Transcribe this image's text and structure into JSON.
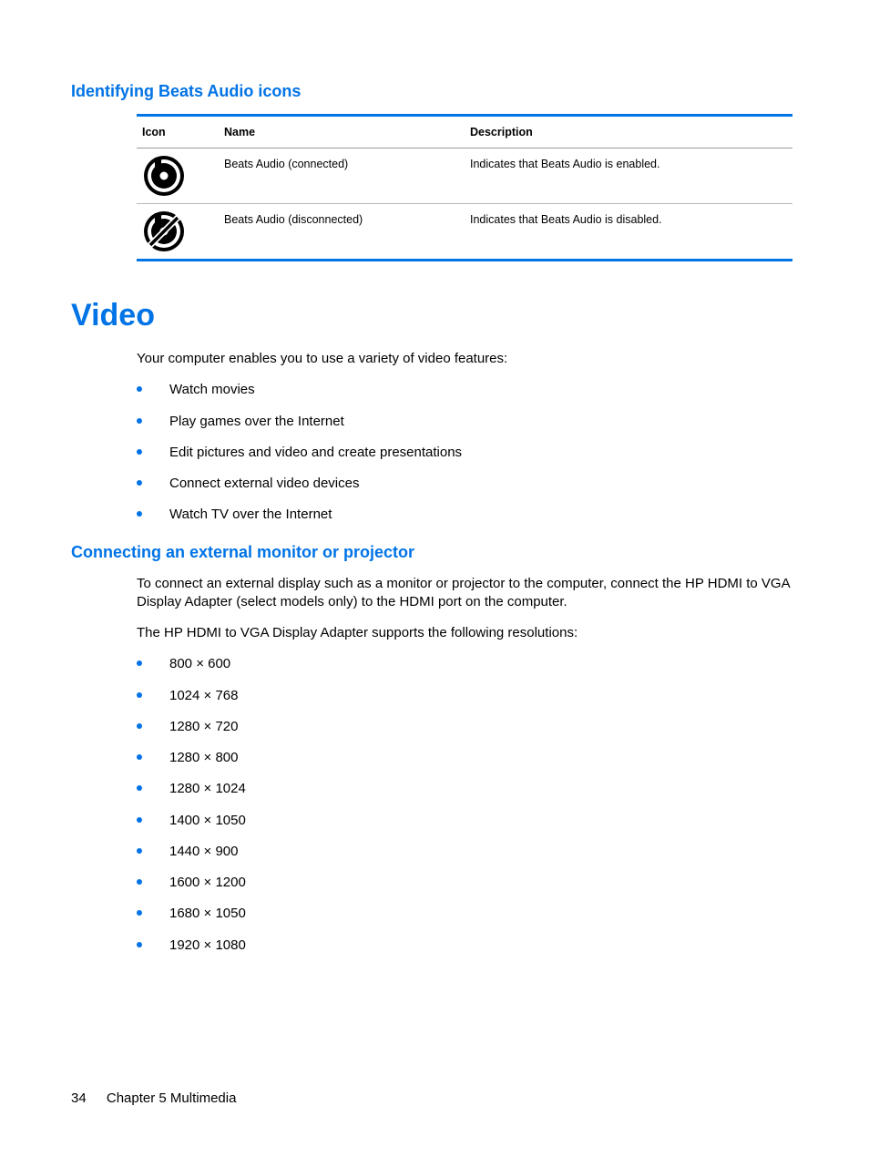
{
  "section1": {
    "heading": "Identifying Beats Audio icons",
    "table": {
      "headers": {
        "icon": "Icon",
        "name": "Name",
        "description": "Description"
      },
      "rows": [
        {
          "name": "Beats Audio (connected)",
          "description": "Indicates that Beats Audio is enabled."
        },
        {
          "name": "Beats Audio (disconnected)",
          "description": "Indicates that Beats Audio is disabled."
        }
      ]
    }
  },
  "section2": {
    "heading": "Video",
    "intro": "Your computer enables you to use a variety of video features:",
    "features": [
      "Watch movies",
      "Play games over the Internet",
      "Edit pictures and video and create presentations",
      "Connect external video devices",
      "Watch TV over the Internet"
    ]
  },
  "section3": {
    "heading": "Connecting an external monitor or projector",
    "para1": "To connect an external display such as a monitor or projector to the computer, connect the HP HDMI to VGA Display Adapter (select models only) to the HDMI port on the computer.",
    "para2": "The HP HDMI to VGA Display Adapter supports the following resolutions:",
    "resolutions": [
      "800 × 600",
      "1024 × 768",
      "1280 × 720",
      "1280 × 800",
      "1280 × 1024",
      "1400 × 1050",
      "1440 × 900",
      "1600 × 1200",
      "1680 × 1050",
      "1920 × 1080"
    ]
  },
  "footer": {
    "pageno": "34",
    "chapter": "Chapter 5   Multimedia"
  }
}
